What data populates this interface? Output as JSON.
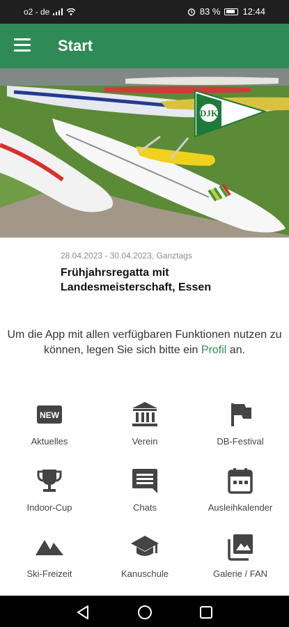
{
  "status_bar": {
    "carrier": "o2 - de",
    "battery": "83 %",
    "time": "12:44"
  },
  "app_bar": {
    "title": "Start",
    "menu_icon": "hamburger-menu-icon"
  },
  "hero": {
    "image": "outrigger canoes on grass with club logo",
    "logo_text": "DJK"
  },
  "event": {
    "date": "28.04.2023 - 30.04.2023, Ganztags",
    "title": "Frühjahrsregatta mit Landesmeisterschaft, Essen"
  },
  "info": {
    "text_before": "Um die App mit allen verfügbaren Funktionen nutzen zu können, legen Sie sich bitte ein",
    "link": "Profil",
    "text_after": "an."
  },
  "tiles": [
    {
      "label": "Aktuelles",
      "icon": "new-badge-icon"
    },
    {
      "label": "Verein",
      "icon": "institution-icon"
    },
    {
      "label": "DB-Festival",
      "icon": "flag-icon"
    },
    {
      "label": "Indoor-Cup",
      "icon": "trophy-icon"
    },
    {
      "label": "Chats",
      "icon": "chat-icon"
    },
    {
      "label": "Ausleihkalender",
      "icon": "calendar-icon"
    },
    {
      "label": "Ski-Freizeit",
      "icon": "mountain-icon"
    },
    {
      "label": "Kanuschule",
      "icon": "school-cap-icon"
    },
    {
      "label": "Galerie / FAN",
      "icon": "gallery-icon"
    }
  ],
  "colors": {
    "primary": "#2e8b57",
    "icon": "#444444"
  }
}
